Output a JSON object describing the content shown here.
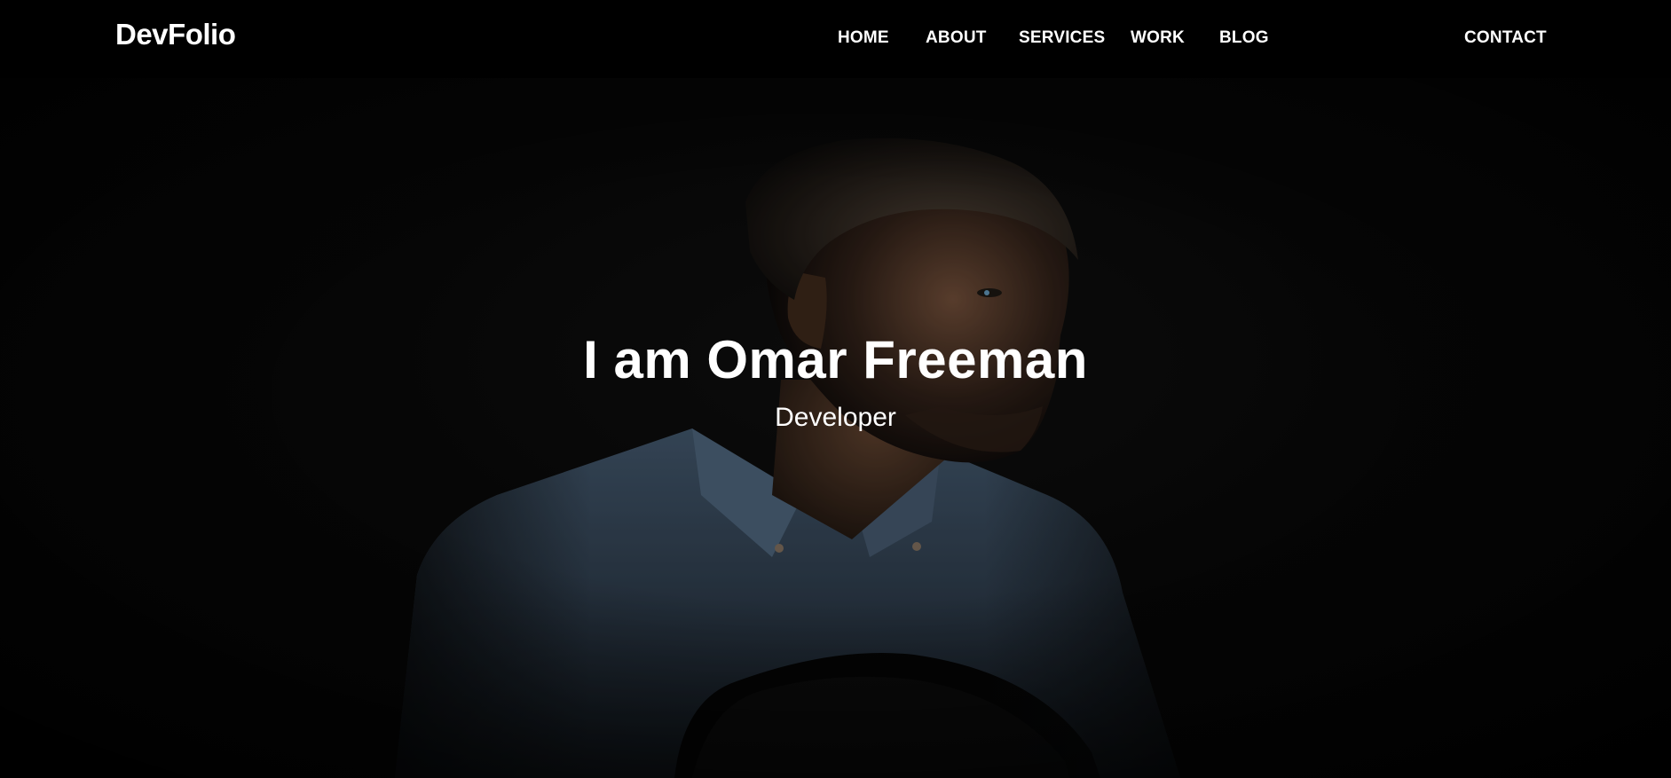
{
  "header": {
    "brand": "DevFolio",
    "nav": {
      "home": "HOME",
      "about": "ABOUT",
      "services": "SERVICES",
      "work": "WORK",
      "blog": "BLOG",
      "contact": "CONTACT"
    }
  },
  "hero": {
    "title": "I am Omar Freeman",
    "subtitle": "Developer"
  },
  "colors": {
    "navbar_bg": "#000000",
    "hero_bg": "#060606",
    "text": "#ffffff",
    "shirt": "#3a4f63"
  }
}
